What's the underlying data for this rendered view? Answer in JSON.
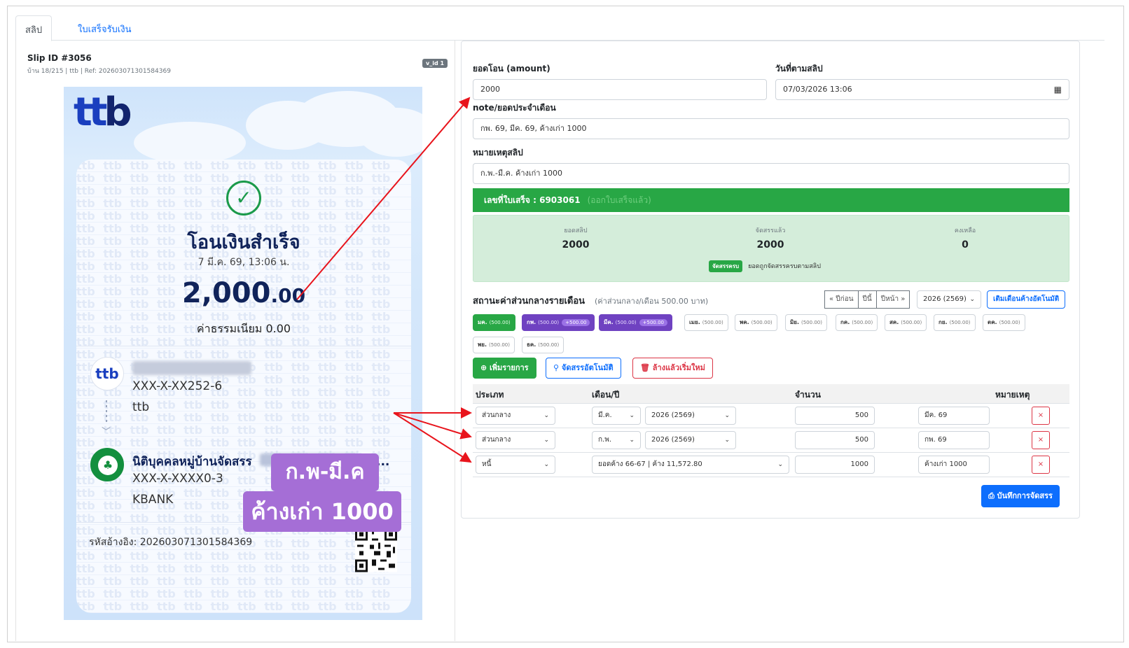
{
  "tabs": [
    {
      "label": "สลิป"
    },
    {
      "label": "ใบเสร็จรับเงิน"
    }
  ],
  "slip_header": {
    "id": "Slip ID #3056",
    "meta": "บ้าน 18/215 | ttb | Ref: 2026030713015​84369",
    "badge": "v_id 1"
  },
  "slip": {
    "logo": "ttb",
    "status": "โอนเงินสำเร็จ",
    "date": "7 มี.ค. 69, 13:06 น.",
    "amount_int": "2,000",
    "amount_dec": ".00",
    "fee": "ค่าธรรมเนียม  0.00",
    "sender_account": "XXX-X-XX252-6",
    "sender_bank": "ttb",
    "receiver_name": "นิติบุคคลหมู่บ้านจัดสรร",
    "receiver_suffix": "-แ...",
    "receiver_account": "XXX-X-XXXX0-3",
    "receiver_bank": "KBANK",
    "ref": "รหัสอ้างอิง: 202603071301584369",
    "overlay_line1": "ก.พ-มี.ค",
    "overlay_line2": "ค้างเก่า 1000",
    "watermark": "ttb"
  },
  "form": {
    "amount_label": "ยอดโอน (amount)",
    "amount_value": "2000",
    "date_label": "วันที่ตามสลิป",
    "date_value": "07/03/2026 13:06",
    "note_label": "note/ยอดประจำเดือน",
    "note_value": "กพ. 69, มีค. 69, ค้างเก่า 1000",
    "remark_label": "หมายเหตุสลิป",
    "remark_value": "ก.พ.-มี.ค. ค้างเก่า 1000"
  },
  "receipt_bar": {
    "text": "เลขที่ใบเสร็จ : 6903061",
    "faint": "(ออกใบเสร็จแล้ว)"
  },
  "allocation": {
    "slip_total_caption": "ยอดสลิป",
    "slip_total": "2000",
    "allocated_caption": "จัดสรรแล้ว",
    "allocated": "2000",
    "remaining_caption": "คงเหลือ",
    "remaining": "0",
    "status_pill": "จัดสรรครบ",
    "status_text": "ยอดถูกจัดสรรครบตามสลิป"
  },
  "monthly": {
    "title": "สถานะค่าส่วนกลางรายเดือน",
    "subtitle": "(ค่าส่วนกลาง/เดือน 500.00 บาท)",
    "prev_year": "« ปีก่อน",
    "this_year": "ปีนี้",
    "next_year": "ปีหน้า »",
    "year_select": "2026 (2569)",
    "auto_fill": "เติมเดือนค้างอัตโนมัติ",
    "months": [
      {
        "name": "มค.",
        "amt": "(500.00)",
        "state": "paid",
        "extra": ""
      },
      {
        "name": "กพ.",
        "amt": "(500.00)",
        "state": "purple",
        "extra": "+500.00"
      },
      {
        "name": "มีค.",
        "amt": "(500.00)",
        "state": "purple",
        "extra": "+500.00"
      },
      {
        "name": "เมย.",
        "amt": "(500.00)",
        "state": "none",
        "extra": ""
      },
      {
        "name": "พค.",
        "amt": "(500.00)",
        "state": "none",
        "extra": ""
      },
      {
        "name": "มิย.",
        "amt": "(500.00)",
        "state": "none",
        "extra": ""
      },
      {
        "name": "กค.",
        "amt": "(500.00)",
        "state": "none",
        "extra": ""
      },
      {
        "name": "สค.",
        "amt": "(500.00)",
        "state": "none",
        "extra": ""
      },
      {
        "name": "กย.",
        "amt": "(500.00)",
        "state": "none",
        "extra": ""
      },
      {
        "name": "ตค.",
        "amt": "(500.00)",
        "state": "none",
        "extra": ""
      },
      {
        "name": "พย.",
        "amt": "(500.00)",
        "state": "none",
        "extra": ""
      },
      {
        "name": "ธค.",
        "amt": "(500.00)",
        "state": "none",
        "extra": ""
      }
    ]
  },
  "actions": {
    "add": "เพิ่มรายการ",
    "auto_alloc": "จัดสรรอัตโนมัติ",
    "clear": "ล้างแล้วเริ่มใหม่",
    "save": "บันทึกการจัดสรร"
  },
  "table": {
    "headers": [
      "ประเภท",
      "เดือน/ปี",
      "จำนวน",
      "หมายเหตุ"
    ],
    "rows": [
      {
        "type": "ส่วนกลาง",
        "month": "มี.ค.",
        "year": "2026 (2569)",
        "amount": "500",
        "note": "มีค. 69"
      },
      {
        "type": "ส่วนกลาง",
        "month": "ก.พ.",
        "year": "2026 (2569)",
        "amount": "500",
        "note": "กพ. 69"
      },
      {
        "type": "หนี้",
        "debt": "ยอดค้าง 66-67 | ค้าง 11,572.80",
        "amount": "1000",
        "note": "ค้างเก่า 1000"
      }
    ],
    "remove": "×"
  },
  "colors": {
    "success": "#28a745",
    "primary": "#0d6efd",
    "danger": "#dc3545",
    "purple": "#6f42c1",
    "annotation": "#e8141c"
  }
}
